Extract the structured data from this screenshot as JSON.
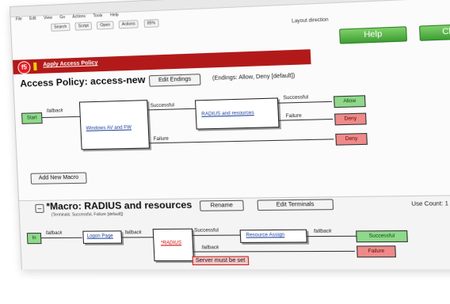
{
  "window": {
    "controls": [
      "_",
      "□",
      "×"
    ]
  },
  "menubar": [
    "File",
    "Edit",
    "View",
    "Go",
    "Actions",
    "Tools",
    "Help"
  ],
  "toolbar": {
    "buttons": [
      "Search",
      "Script",
      "Open",
      "Actions"
    ],
    "layout_direction": "Layout direction",
    "zoom": "85%"
  },
  "header": {
    "help_label": "Help",
    "close_label": "Close",
    "brand": "f5",
    "apply_label": "Apply Access Policy"
  },
  "policy": {
    "title": "Access Policy: access-new",
    "edit_endings_label": "Edit Endings",
    "endings_text": "(Endings: Allow, Deny [default])",
    "start_label": "Start",
    "fallback_label": "fallback",
    "windows_label": "Windows AV and FW",
    "radius_label": "RADIUS and resources",
    "successful_label": "Successful",
    "failure_label": "Failure",
    "allow_label": "Allow",
    "deny_label": "Deny",
    "add_macro_label": "Add New Macro"
  },
  "macro": {
    "collapse_symbol": "–",
    "title": "*Macro: RADIUS and resources",
    "terminals_text": "(Terminals: Successful, Failure [default])",
    "rename_label": "Rename",
    "edit_terminals_label": "Edit Terminals",
    "use_count": "Use Count: 1",
    "in_label": "In",
    "fallback_label": "fallback",
    "logon_label": "Logon Page",
    "radius_label": "*RADIUS",
    "successful_label": "Successful",
    "resource_label": "Resource Assign",
    "success_term": "Successful",
    "failure_term": "Failure",
    "error_text": "Server must be set"
  }
}
